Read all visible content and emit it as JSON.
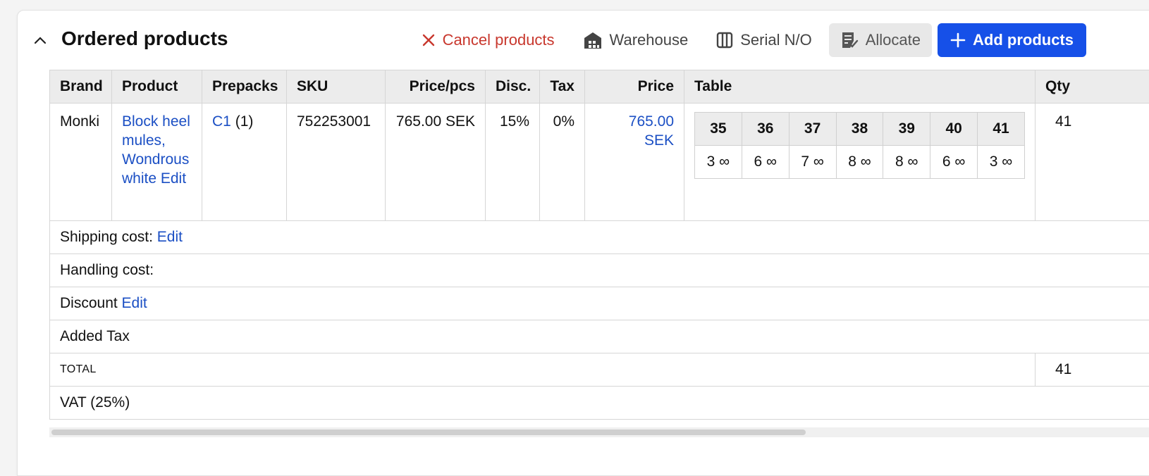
{
  "header": {
    "title": "Ordered products",
    "buttons": {
      "cancel": "Cancel products",
      "warehouse": "Warehouse",
      "serial": "Serial N/O",
      "allocate": "Allocate",
      "add": "Add products"
    }
  },
  "columns": [
    "Brand",
    "Product",
    "Prepacks",
    "SKU",
    "Price/pcs",
    "Disc.",
    "Tax",
    "Price",
    "Table",
    "Qty"
  ],
  "row": {
    "brand": "Monki",
    "product": "Block heel mules, Wondrous white",
    "product_edit": "Edit",
    "prepack_link": "C1",
    "prepack_count": "(1)",
    "sku": "752253001",
    "price_pcs": "765.00 SEK",
    "disc": "15%",
    "tax": "0%",
    "price": "765.00 SEK",
    "qty": "41",
    "sizes": [
      {
        "size": "35",
        "qty": "3 ∞"
      },
      {
        "size": "36",
        "qty": "6 ∞"
      },
      {
        "size": "37",
        "qty": "7 ∞"
      },
      {
        "size": "38",
        "qty": "8 ∞"
      },
      {
        "size": "39",
        "qty": "8 ∞"
      },
      {
        "size": "40",
        "qty": "6 ∞"
      },
      {
        "size": "41",
        "qty": "3 ∞"
      }
    ]
  },
  "summary": {
    "shipping_label": "Shipping cost:",
    "shipping_edit": "Edit",
    "handling_label": "Handling cost:",
    "discount_label": "Discount",
    "discount_edit": "Edit",
    "added_tax_label": "Added Tax",
    "total_label": "TOTAL",
    "total_qty": "41",
    "vat_label": "VAT (25%)"
  },
  "icons": {
    "collapse": "chevron-up-icon",
    "cancel": "close-icon",
    "warehouse": "warehouse-icon",
    "serial": "columns-icon",
    "allocate": "checklist-icon",
    "add": "plus-icon"
  },
  "colors": {
    "primary": "#1650e8",
    "link": "#1b4fc4",
    "danger": "#c8372d"
  }
}
